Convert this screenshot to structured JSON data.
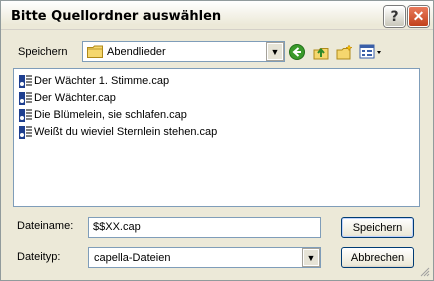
{
  "window": {
    "title": "Bitte Quellordner auswählen",
    "help_label": "?",
    "close_label": "✕"
  },
  "location": {
    "label": "Speichern",
    "current_folder": "Abendlieder"
  },
  "toolbar": {
    "icons": [
      "back-icon",
      "up-folder-icon",
      "new-folder-icon",
      "view-menu-icon"
    ]
  },
  "files": [
    {
      "name": "Der Wächter 1. Stimme.cap"
    },
    {
      "name": "Der Wächter.cap"
    },
    {
      "name": "Die Blümelein, sie schlafen.cap"
    },
    {
      "name": "Weißt du wieviel Sternlein stehen.cap"
    }
  ],
  "filename": {
    "label": "Dateiname:",
    "value": "$$XX.cap"
  },
  "filetype": {
    "label": "Dateityp:",
    "selected": "capella-Dateien"
  },
  "buttons": {
    "save": "Speichern",
    "cancel": "Abbrechen"
  },
  "colors": {
    "dialog_bg": "#ece9d8",
    "border_blue": "#7f9db9",
    "back_green": "#3a9a2a"
  }
}
